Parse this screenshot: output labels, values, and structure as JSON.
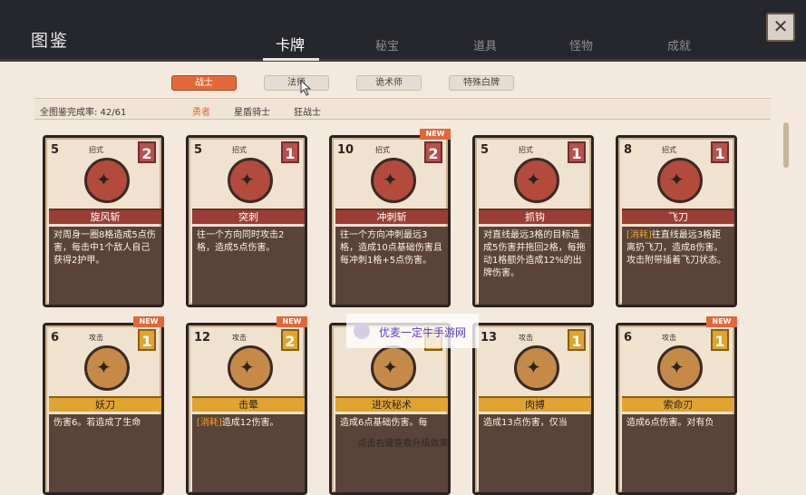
{
  "header": {
    "title": "图鉴"
  },
  "tabs": [
    {
      "label": "卡牌",
      "active": true
    },
    {
      "label": "秘宝"
    },
    {
      "label": "道具"
    },
    {
      "label": "怪物"
    },
    {
      "label": "成就"
    }
  ],
  "close_label": "✕",
  "classes": [
    {
      "label": "战士",
      "active": true
    },
    {
      "label": "法师"
    },
    {
      "label": "诡术师"
    },
    {
      "label": "特殊白牌"
    }
  ],
  "completion": "全图鉴完成率: 42/61",
  "subclasses": [
    {
      "label": "勇者",
      "active": true
    },
    {
      "label": "星盾骑士"
    },
    {
      "label": "狂战士"
    }
  ],
  "cards": [
    {
      "cost": "5",
      "kind": "招式",
      "level": "2",
      "name": "旋风斩",
      "desc": "对周身一圈8格造成5点伤害，每击中1个敌人自己获得2护甲。",
      "new": false,
      "row": 0
    },
    {
      "cost": "5",
      "kind": "招式",
      "level": "1",
      "name": "突刺",
      "desc": "往一个方向同时攻击2格，造成5点伤害。",
      "new": false,
      "row": 0
    },
    {
      "cost": "10",
      "kind": "招式",
      "level": "2",
      "name": "冲刺斩",
      "desc": "往一个方向冲刺最远3格，造成10点基础伤害且每冲刺1格+5点伤害。",
      "new": true,
      "row": 0
    },
    {
      "cost": "5",
      "kind": "招式",
      "level": "1",
      "name": "抓钩",
      "desc": "对直线最远3格的目标造成5伤害并拖回2格，每拖动1格额外造成12%的出牌伤害。",
      "new": false,
      "row": 0
    },
    {
      "cost": "8",
      "kind": "招式",
      "level": "1",
      "name": "飞刀",
      "desc_kw": "[消耗]",
      "desc": "往直线最远3格距离扔飞刀，造成8伤害。攻击附带插着飞刀状态。",
      "new": false,
      "row": 0
    },
    {
      "cost": "6",
      "kind": "攻击",
      "level": "1",
      "name": "妖刀",
      "desc": "伤害6。若造成了生命",
      "new": true,
      "row": 1
    },
    {
      "cost": "12",
      "kind": "攻击",
      "level": "2",
      "name": "击晕",
      "desc_kw": "[消耗]",
      "desc": "造成12伤害。",
      "new": true,
      "row": 1
    },
    {
      "cost": "",
      "kind": "",
      "level": "",
      "name": "进攻秘术",
      "desc": "造成6点基础伤害。每",
      "new": false,
      "row": 1
    },
    {
      "cost": "13",
      "kind": "攻击",
      "level": "1",
      "name": "肉搏",
      "desc": "造成13点伤害，仅当",
      "new": false,
      "row": 1
    },
    {
      "cost": "6",
      "kind": "攻击",
      "level": "1",
      "name": "索命刃",
      "desc": "造成6点伤害。对有负",
      "new": true,
      "row": 1
    }
  ],
  "new_label": "NEW",
  "watermark": "优麦一定牛手游网",
  "footer": "点击右键查看升级效果",
  "colors": {
    "accent": "#e2673a",
    "card_red": "#9a3d36",
    "card_gold": "#e0a431",
    "header_bg": "#26272c"
  }
}
